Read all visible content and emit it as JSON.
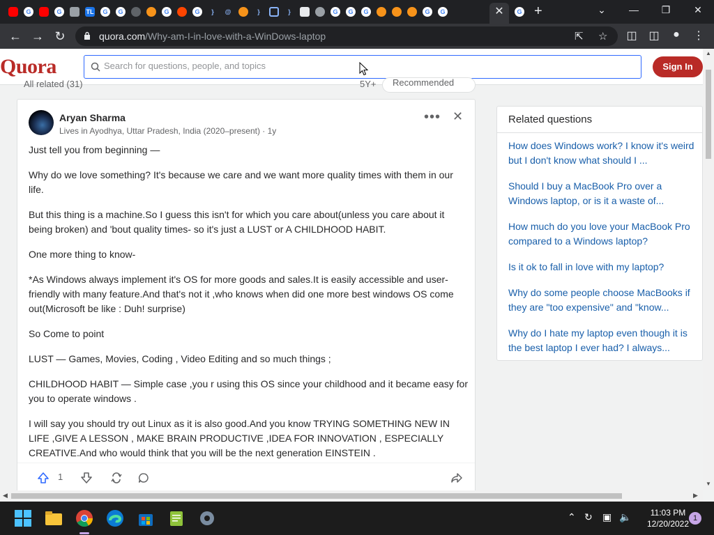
{
  "browser": {
    "url_domain": "quora.com",
    "url_path": "/Why-am-I-in-love-with-a-WinDows-laptop",
    "active_tab_close": "✕",
    "new_tab": "+"
  },
  "quora": {
    "logo": "Quora",
    "search_placeholder": "Search for questions, people, and topics",
    "signin_label": "Sign In",
    "all_related": "All related (31)",
    "partial_right": "5Y+",
    "recommended": "Recommended"
  },
  "answer": {
    "author": "Aryan Sharma",
    "credential": "Lives in Ayodhya, Uttar Pradesh, India (2020–present) · 1y",
    "paragraphs": [
      "Just tell you from beginning —",
      "Why do we love something? It's because we care and we want more quality times with them in our life.",
      "But this thing is a machine.So I guess this isn't for which you care about(unless you care about it being broken) and 'bout quality times- so it's just a LUST or A CHILDHOOD HABIT.",
      "One more thing to know-",
      "*As Windows always implement it's OS for more goods and sales.It is easily accessible and user-friendly with many feature.And that's not it ,who knows when did one more best windows OS come out(Microsoft be like : Duh! surprise)",
      "So Come to point",
      "LUST — Games, Movies, Coding , Video Editing and so much things ;",
      "CHILDHOOD HABIT — Simple case ,you r using this OS since your childhood and it became easy for you to operate windows .",
      "I will say you should try out Linux as it is also good.And you know TRYING SOMETHING NEW IN LIFE ,GIVE A LESSON , MAKE BRAIN PRODUCTIVE ,IDEA FOR INNOVATION , ESPECIALLY CREATIVE.And who would think that you will be the next generation EINSTEIN ."
    ],
    "upvote_count": "1"
  },
  "related": {
    "title": "Related questions",
    "items": [
      "How does Windows work? I know it's weird but I don't know what should I ...",
      "Should I buy a MacBook Pro over a Windows laptop, or is it a waste of...",
      "How much do you love your MacBook Pro compared to a Windows laptop?",
      "Is it ok to fall in love with my laptop?",
      "Why do some people choose MacBooks if they are \"too expensive\" and \"know...",
      "Why do I hate my laptop even though it is the best laptop I ever had? I always..."
    ]
  },
  "taskbar": {
    "time": "11:03 PM",
    "date": "12/20/2022",
    "notifications": "1"
  },
  "colors": {
    "quora_red": "#b92b27",
    "link_blue": "#195faa",
    "search_border": "#2e69ff"
  }
}
